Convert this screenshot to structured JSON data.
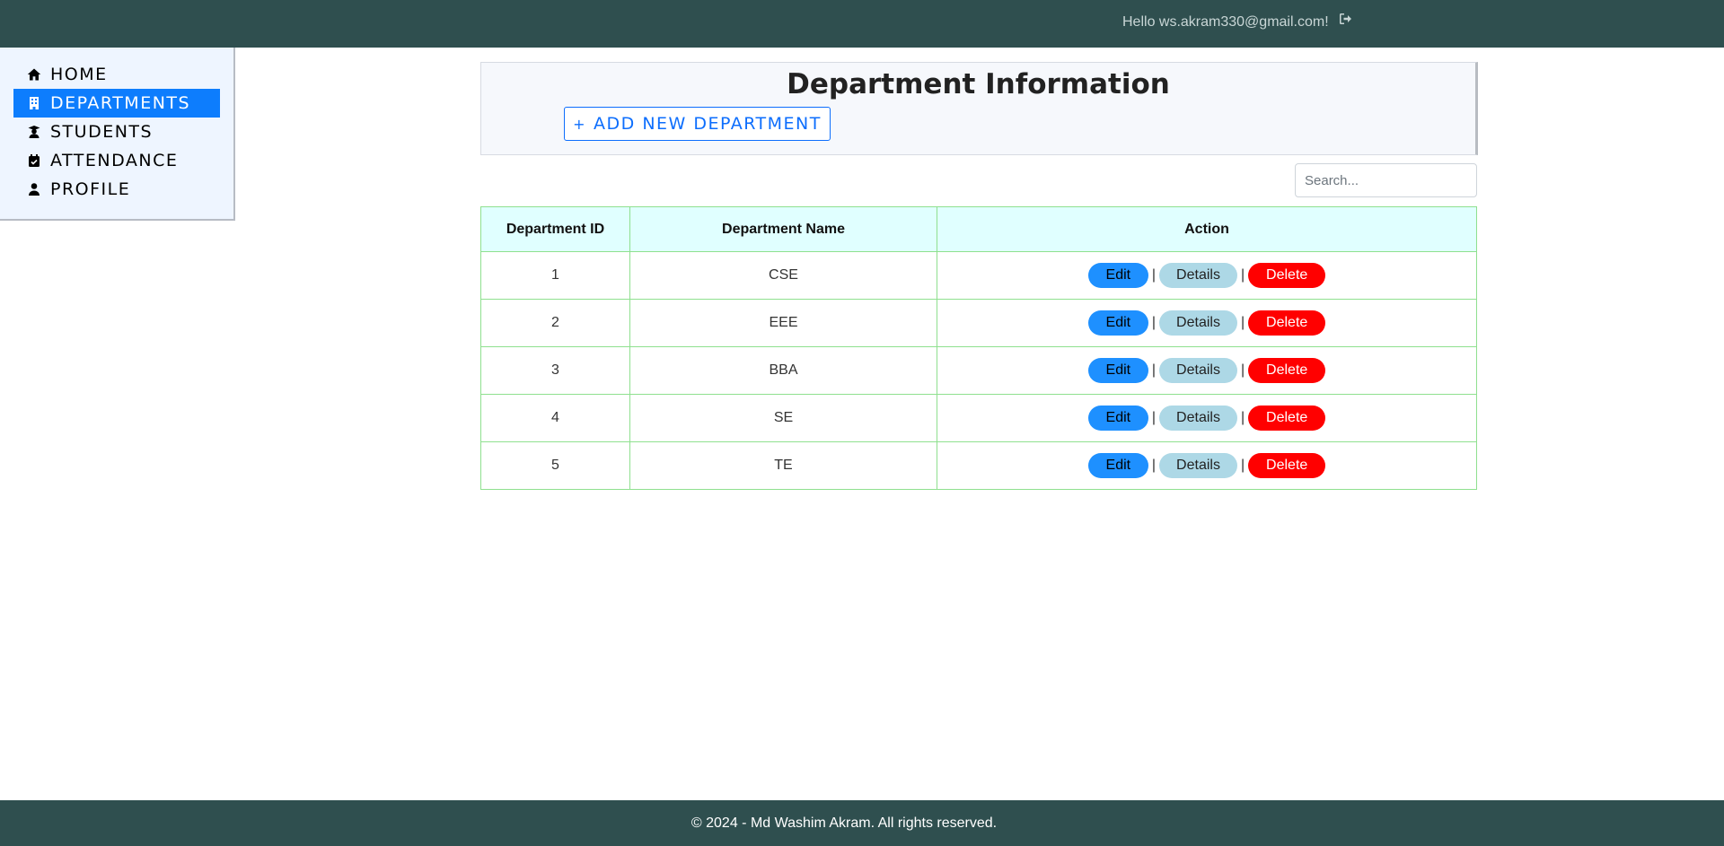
{
  "topbar": {
    "greeting": "Hello ws.akram330@gmail.com!",
    "logout_icon": "sign-out-icon",
    "background": "#2f4f4f"
  },
  "sidebar": {
    "items": [
      {
        "label": "HOME",
        "icon": "home-icon",
        "active": false
      },
      {
        "label": "DEPARTMENTS",
        "icon": "building-icon",
        "active": true
      },
      {
        "label": "STUDENTS",
        "icon": "graduate-icon",
        "active": false
      },
      {
        "label": "ATTENDANCE",
        "icon": "calendar-check-icon",
        "active": false
      },
      {
        "label": "PROFILE",
        "icon": "user-icon",
        "active": false
      }
    ],
    "active_color": "#0d7dfd"
  },
  "header": {
    "title": "Department Information",
    "add_button_plus": "+",
    "add_button_label": "ADD NEW DEPARTMENT"
  },
  "search": {
    "placeholder": "Search...",
    "value": ""
  },
  "table": {
    "columns": [
      "Department ID",
      "Department Name",
      "Action"
    ],
    "rows": [
      {
        "id": "1",
        "name": "CSE"
      },
      {
        "id": "2",
        "name": "EEE"
      },
      {
        "id": "3",
        "name": "BBA"
      },
      {
        "id": "4",
        "name": "SE"
      },
      {
        "id": "5",
        "name": "TE"
      }
    ],
    "actions": {
      "edit": "Edit",
      "details": "Details",
      "delete": "Delete",
      "separator": "|"
    }
  },
  "footer": {
    "text": "© 2024 - Md Washim Akram. All rights reserved."
  }
}
